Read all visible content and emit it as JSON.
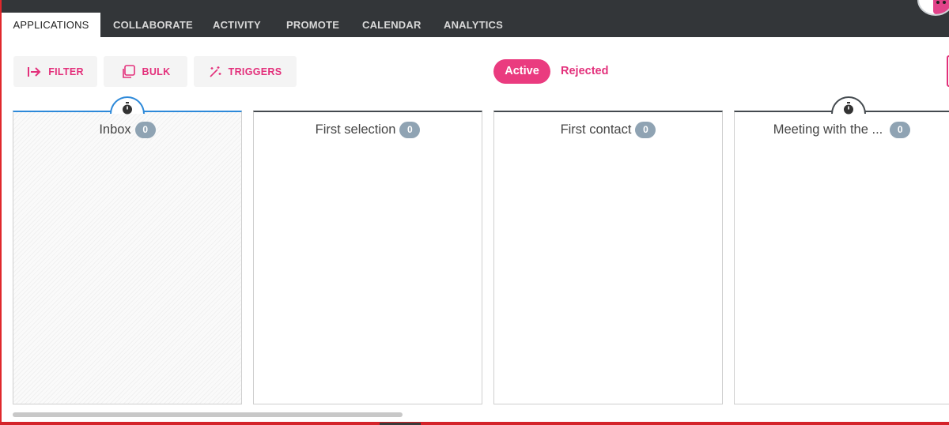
{
  "tabs": [
    {
      "label": "APPLICATIONS",
      "active": true
    },
    {
      "label": "COLLABORATE",
      "active": false
    },
    {
      "label": "ACTIVITY",
      "active": false
    },
    {
      "label": "PROMOTE",
      "active": false
    },
    {
      "label": "CALENDAR",
      "active": false
    },
    {
      "label": "ANALYTICS",
      "active": false
    }
  ],
  "toolbar": {
    "filter_label": "FILTER",
    "bulk_label": "BULK",
    "triggers_label": "TRIGGERS"
  },
  "status_toggle": {
    "active_label": "Active",
    "rejected_label": "Rejected"
  },
  "columns": [
    {
      "title": "Inbox",
      "count": "0",
      "has_timer": true
    },
    {
      "title": "First selection",
      "count": "0",
      "has_timer": false
    },
    {
      "title": "First contact",
      "count": "0",
      "has_timer": false
    },
    {
      "title": "Meeting with the ...",
      "count": "0",
      "has_timer": true
    }
  ],
  "icons": {
    "filter": "arrow-right-to-bar-icon",
    "bulk": "copy-icon",
    "triggers": "magic-wand-icon",
    "timer": "stopwatch-icon",
    "avatar": "user-avatar"
  },
  "colors": {
    "accent": "#ea3b7f",
    "topbar": "#333639",
    "inbox_border": "#2d89d9",
    "column_border": "#444a4f",
    "badge": "#8fa3b3"
  }
}
